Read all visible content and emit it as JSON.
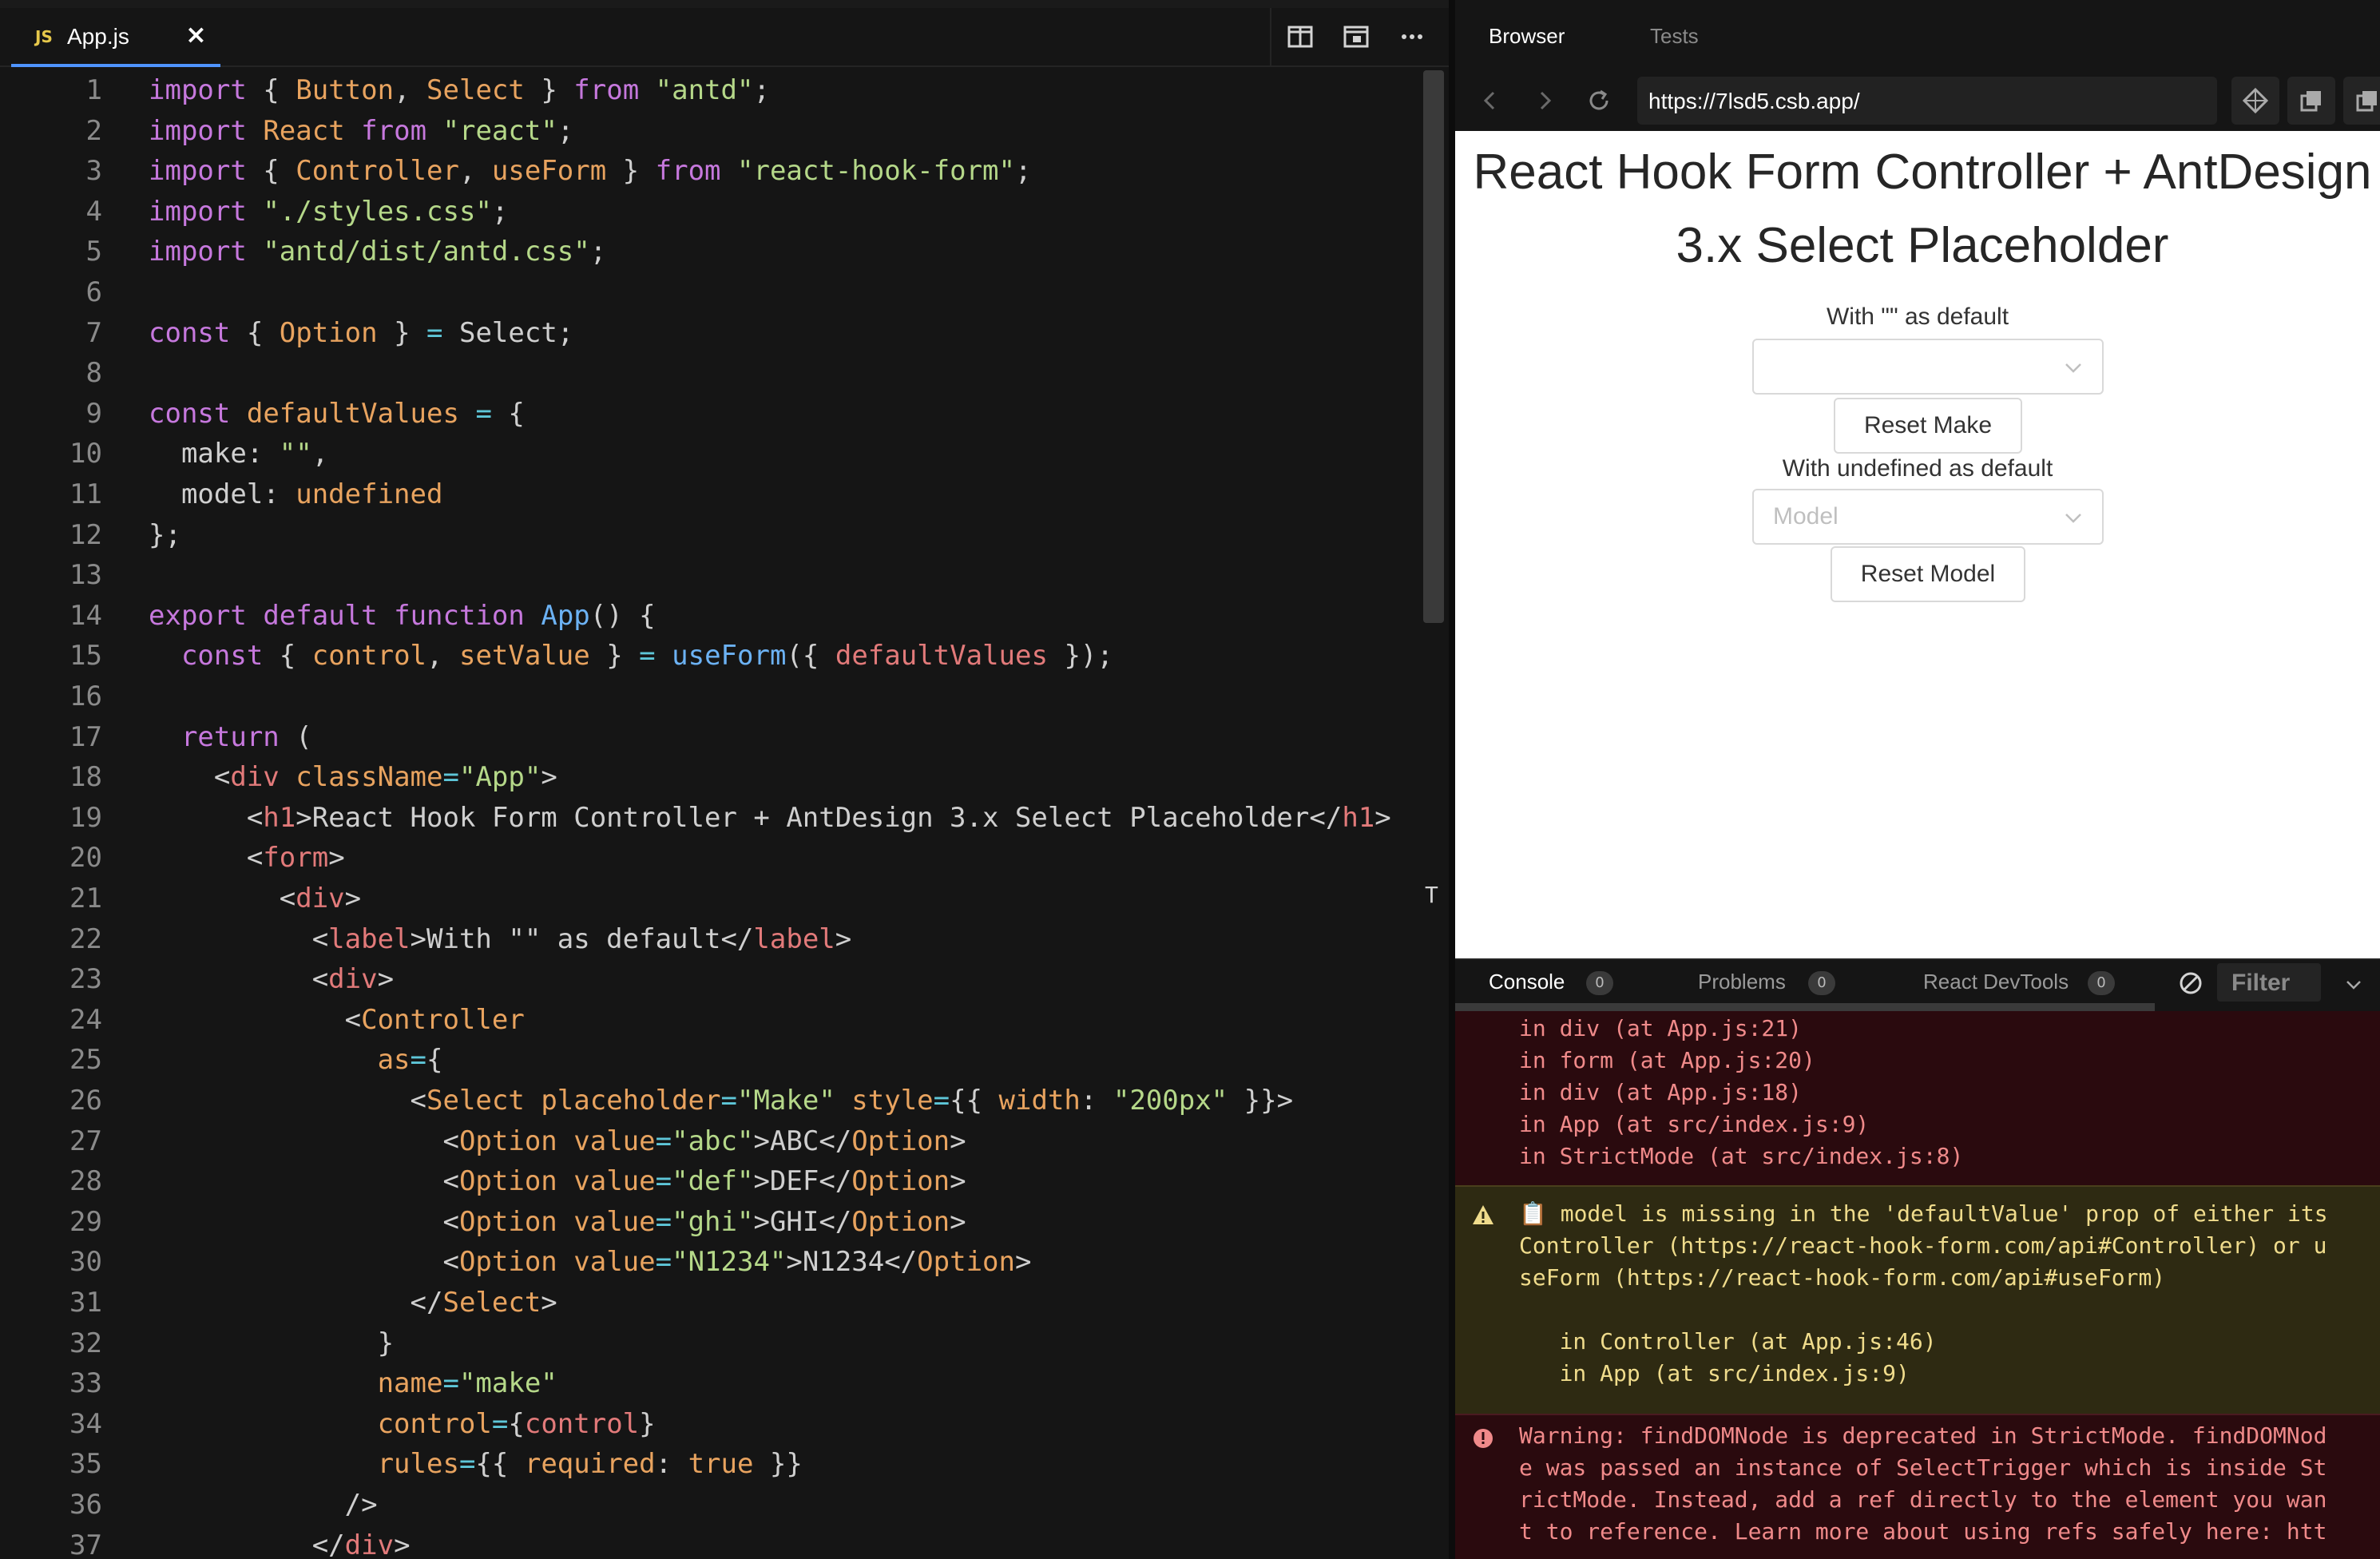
{
  "editor": {
    "tab": {
      "badge": "JS",
      "label": "App.js",
      "close": "×"
    },
    "lines": [
      {
        "n": "1"
      },
      {
        "n": "2"
      },
      {
        "n": "3"
      },
      {
        "n": "4"
      },
      {
        "n": "5"
      },
      {
        "n": "6"
      },
      {
        "n": "7"
      },
      {
        "n": "8"
      },
      {
        "n": "9"
      },
      {
        "n": "10"
      },
      {
        "n": "11"
      },
      {
        "n": "12"
      },
      {
        "n": "13"
      },
      {
        "n": "14"
      },
      {
        "n": "15"
      },
      {
        "n": "16"
      },
      {
        "n": "17"
      },
      {
        "n": "18"
      },
      {
        "n": "19"
      },
      {
        "n": "20"
      },
      {
        "n": "21"
      },
      {
        "n": "22"
      },
      {
        "n": "23"
      },
      {
        "n": "24"
      },
      {
        "n": "25"
      },
      {
        "n": "26"
      },
      {
        "n": "27"
      },
      {
        "n": "28"
      },
      {
        "n": "29"
      },
      {
        "n": "30"
      },
      {
        "n": "31"
      },
      {
        "n": "32"
      },
      {
        "n": "33"
      },
      {
        "n": "34"
      },
      {
        "n": "35"
      },
      {
        "n": "36"
      },
      {
        "n": "37"
      }
    ],
    "code": [
      [
        [
          "k",
          "import"
        ],
        [
          "p",
          " { "
        ],
        [
          "v",
          "Button"
        ],
        [
          "p",
          ", "
        ],
        [
          "v",
          "Select"
        ],
        [
          "p",
          " } "
        ],
        [
          "k",
          "from"
        ],
        [
          "p",
          " "
        ],
        [
          "s",
          "\"antd\""
        ],
        [
          "p",
          ";"
        ]
      ],
      [
        [
          "k",
          "import"
        ],
        [
          "p",
          " "
        ],
        [
          "v",
          "React"
        ],
        [
          "p",
          " "
        ],
        [
          "k",
          "from"
        ],
        [
          "p",
          " "
        ],
        [
          "s",
          "\"react\""
        ],
        [
          "p",
          ";"
        ]
      ],
      [
        [
          "k",
          "import"
        ],
        [
          "p",
          " { "
        ],
        [
          "v",
          "Controller"
        ],
        [
          "p",
          ", "
        ],
        [
          "v",
          "useForm"
        ],
        [
          "p",
          " } "
        ],
        [
          "k",
          "from"
        ],
        [
          "p",
          " "
        ],
        [
          "s",
          "\"react-hook-form\""
        ],
        [
          "p",
          ";"
        ]
      ],
      [
        [
          "k",
          "import"
        ],
        [
          "p",
          " "
        ],
        [
          "s",
          "\"./styles.css\""
        ],
        [
          "p",
          ";"
        ]
      ],
      [
        [
          "k",
          "import"
        ],
        [
          "p",
          " "
        ],
        [
          "s",
          "\"antd/dist/antd.css\""
        ],
        [
          "p",
          ";"
        ]
      ],
      [],
      [
        [
          "k",
          "const"
        ],
        [
          "p",
          " { "
        ],
        [
          "v",
          "Option"
        ],
        [
          "p",
          " } "
        ],
        [
          "c",
          "="
        ],
        [
          "p",
          " Select;"
        ]
      ],
      [],
      [
        [
          "k",
          "const"
        ],
        [
          "p",
          " "
        ],
        [
          "v",
          "defaultValues"
        ],
        [
          "p",
          " "
        ],
        [
          "c",
          "="
        ],
        [
          "p",
          " {"
        ]
      ],
      [
        [
          "p",
          "  make: "
        ],
        [
          "s",
          "\"\""
        ],
        [
          "p",
          ","
        ]
      ],
      [
        [
          "p",
          "  model: "
        ],
        [
          "b",
          "undefined"
        ]
      ],
      [
        [
          "p",
          "};"
        ]
      ],
      [],
      [
        [
          "k",
          "export"
        ],
        [
          "p",
          " "
        ],
        [
          "k",
          "default"
        ],
        [
          "p",
          " "
        ],
        [
          "k",
          "function"
        ],
        [
          "p",
          " "
        ],
        [
          "f",
          "App"
        ],
        [
          "p",
          "() {"
        ]
      ],
      [
        [
          "p",
          "  "
        ],
        [
          "k",
          "const"
        ],
        [
          "p",
          " { "
        ],
        [
          "v",
          "control"
        ],
        [
          "p",
          ", "
        ],
        [
          "v",
          "setValue"
        ],
        [
          "p",
          " } "
        ],
        [
          "c",
          "="
        ],
        [
          "p",
          " "
        ],
        [
          "f",
          "useForm"
        ],
        [
          "p",
          "({ "
        ],
        [
          "t",
          "defaultValues"
        ],
        [
          "p",
          " });"
        ]
      ],
      [],
      [
        [
          "p",
          "  "
        ],
        [
          "k",
          "return"
        ],
        [
          "p",
          " ("
        ]
      ],
      [
        [
          "p",
          "    <"
        ],
        [
          "t",
          "div"
        ],
        [
          "p",
          " "
        ],
        [
          "v",
          "className"
        ],
        [
          "c",
          "="
        ],
        [
          "s",
          "\"App\""
        ],
        [
          "p",
          ">"
        ]
      ],
      [
        [
          "p",
          "      <"
        ],
        [
          "t",
          "h1"
        ],
        [
          "p",
          ">React Hook Form Controller + AntDesign 3.x Select Placeholder</"
        ],
        [
          "t",
          "h1"
        ],
        [
          "p",
          ">"
        ]
      ],
      [
        [
          "p",
          "      <"
        ],
        [
          "t",
          "form"
        ],
        [
          "p",
          ">"
        ]
      ],
      [
        [
          "p",
          "        <"
        ],
        [
          "t",
          "div"
        ],
        [
          "p",
          ">"
        ]
      ],
      [
        [
          "p",
          "          <"
        ],
        [
          "t",
          "label"
        ],
        [
          "p",
          ">With \"\" as default</"
        ],
        [
          "t",
          "label"
        ],
        [
          "p",
          ">"
        ]
      ],
      [
        [
          "p",
          "          <"
        ],
        [
          "t",
          "div"
        ],
        [
          "p",
          ">"
        ]
      ],
      [
        [
          "p",
          "            <"
        ],
        [
          "v",
          "Controller"
        ]
      ],
      [
        [
          "p",
          "              "
        ],
        [
          "v",
          "as"
        ],
        [
          "c",
          "="
        ],
        [
          "p",
          "{"
        ]
      ],
      [
        [
          "p",
          "                <"
        ],
        [
          "v",
          "Select"
        ],
        [
          "p",
          " "
        ],
        [
          "v",
          "placeholder"
        ],
        [
          "c",
          "="
        ],
        [
          "s",
          "\"Make\""
        ],
        [
          "p",
          " "
        ],
        [
          "v",
          "style"
        ],
        [
          "c",
          "="
        ],
        [
          "p",
          "{{ "
        ],
        [
          "v",
          "width"
        ],
        [
          "p",
          ": "
        ],
        [
          "s",
          "\"200px\""
        ],
        [
          "p",
          " }}>"
        ]
      ],
      [
        [
          "p",
          "                  <"
        ],
        [
          "v",
          "Option"
        ],
        [
          "p",
          " "
        ],
        [
          "v",
          "value"
        ],
        [
          "c",
          "="
        ],
        [
          "s",
          "\"abc\""
        ],
        [
          "p",
          ">ABC</"
        ],
        [
          "v",
          "Option"
        ],
        [
          "p",
          ">"
        ]
      ],
      [
        [
          "p",
          "                  <"
        ],
        [
          "v",
          "Option"
        ],
        [
          "p",
          " "
        ],
        [
          "v",
          "value"
        ],
        [
          "c",
          "="
        ],
        [
          "s",
          "\"def\""
        ],
        [
          "p",
          ">DEF</"
        ],
        [
          "v",
          "Option"
        ],
        [
          "p",
          ">"
        ]
      ],
      [
        [
          "p",
          "                  <"
        ],
        [
          "v",
          "Option"
        ],
        [
          "p",
          " "
        ],
        [
          "v",
          "value"
        ],
        [
          "c",
          "="
        ],
        [
          "s",
          "\"ghi\""
        ],
        [
          "p",
          ">GHI</"
        ],
        [
          "v",
          "Option"
        ],
        [
          "p",
          ">"
        ]
      ],
      [
        [
          "p",
          "                  <"
        ],
        [
          "v",
          "Option"
        ],
        [
          "p",
          " "
        ],
        [
          "v",
          "value"
        ],
        [
          "c",
          "="
        ],
        [
          "s",
          "\"N1234\""
        ],
        [
          "p",
          ">N1234</"
        ],
        [
          "v",
          "Option"
        ],
        [
          "p",
          ">"
        ]
      ],
      [
        [
          "p",
          "                </"
        ],
        [
          "v",
          "Select"
        ],
        [
          "p",
          ">"
        ]
      ],
      [
        [
          "p",
          "              }"
        ]
      ],
      [
        [
          "p",
          "              "
        ],
        [
          "v",
          "name"
        ],
        [
          "c",
          "="
        ],
        [
          "s",
          "\"make\""
        ]
      ],
      [
        [
          "p",
          "              "
        ],
        [
          "v",
          "control"
        ],
        [
          "c",
          "="
        ],
        [
          "p",
          "{"
        ],
        [
          "t",
          "control"
        ],
        [
          "p",
          "}"
        ]
      ],
      [
        [
          "p",
          "              "
        ],
        [
          "v",
          "rules"
        ],
        [
          "c",
          "="
        ],
        [
          "p",
          "{{ "
        ],
        [
          "v",
          "required"
        ],
        [
          "p",
          ": "
        ],
        [
          "b",
          "true"
        ],
        [
          "p",
          " }}"
        ]
      ],
      [
        [
          "p",
          "            />"
        ]
      ],
      [
        [
          "p",
          "          </"
        ],
        [
          "t",
          "div"
        ],
        [
          "p",
          ">"
        ]
      ]
    ],
    "marker": "T"
  },
  "browser": {
    "tabs": {
      "browser": "Browser",
      "tests": "Tests"
    },
    "url": "https://7lsd5.csb.app/",
    "preview": {
      "title": "React Hook Form Controller + AntDesign 3.x Select Placeholder",
      "label1": "With \"\" as default",
      "select1_placeholder": "",
      "button1": "Reset Make",
      "label2": "With undefined as default",
      "select2_placeholder": "Model",
      "button2": "Reset Model"
    }
  },
  "console": {
    "tabs": {
      "console": "Console",
      "console_count": "0",
      "problems": "Problems",
      "problems_count": "0",
      "devtools": "React DevTools",
      "devtools_count": "0"
    },
    "filter": "Filter",
    "error_trace": [
      "in div (at App.js:21)",
      "in form (at App.js:20)",
      "in div (at App.js:18)",
      "in App (at src/index.js:9)",
      "in StrictMode (at src/index.js:8)"
    ],
    "warning": [
      "📋 model is missing in the 'defaultValue' prop of either its",
      "Controller (https://react-hook-form.com/api#Controller) or u",
      "seForm (https://react-hook-form.com/api#useForm)",
      "",
      "   in Controller (at App.js:46)",
      "   in App (at src/index.js:9)"
    ],
    "error2": [
      "Warning: findDOMNode is deprecated in StrictMode. findDOMNod",
      "e was passed an instance of SelectTrigger which is inside St",
      "rictMode. Instead, add a ref directly to the element you wan",
      "t to reference. Learn more about using refs safely here: htt"
    ]
  }
}
